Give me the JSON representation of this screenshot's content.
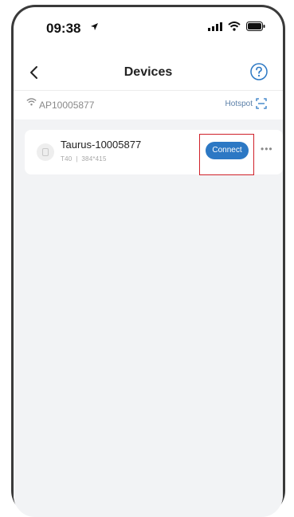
{
  "status_bar": {
    "time": "09:38",
    "icons": [
      "location-arrow-icon",
      "cellular-signal-icon",
      "wifi-icon",
      "battery-icon"
    ]
  },
  "nav": {
    "title": "Devices",
    "back_icon": "chevron-left-icon",
    "help_icon": "question-circle-icon"
  },
  "network": {
    "name": "AP10005877",
    "hotspot_label": "Hotspot",
    "wifi_icon": "wifi-icon",
    "scan_icon": "scan-icon"
  },
  "devices": [
    {
      "name": "Taurus-10005877",
      "model": "T40",
      "separator": "|",
      "resolution": "384*415",
      "action_label": "Connect",
      "more_icon": "more-icon"
    }
  ],
  "colors": {
    "accent": "#2c78c4",
    "highlight": "#d0212a",
    "background": "#f2f3f5",
    "link": "#5a7fa8"
  }
}
